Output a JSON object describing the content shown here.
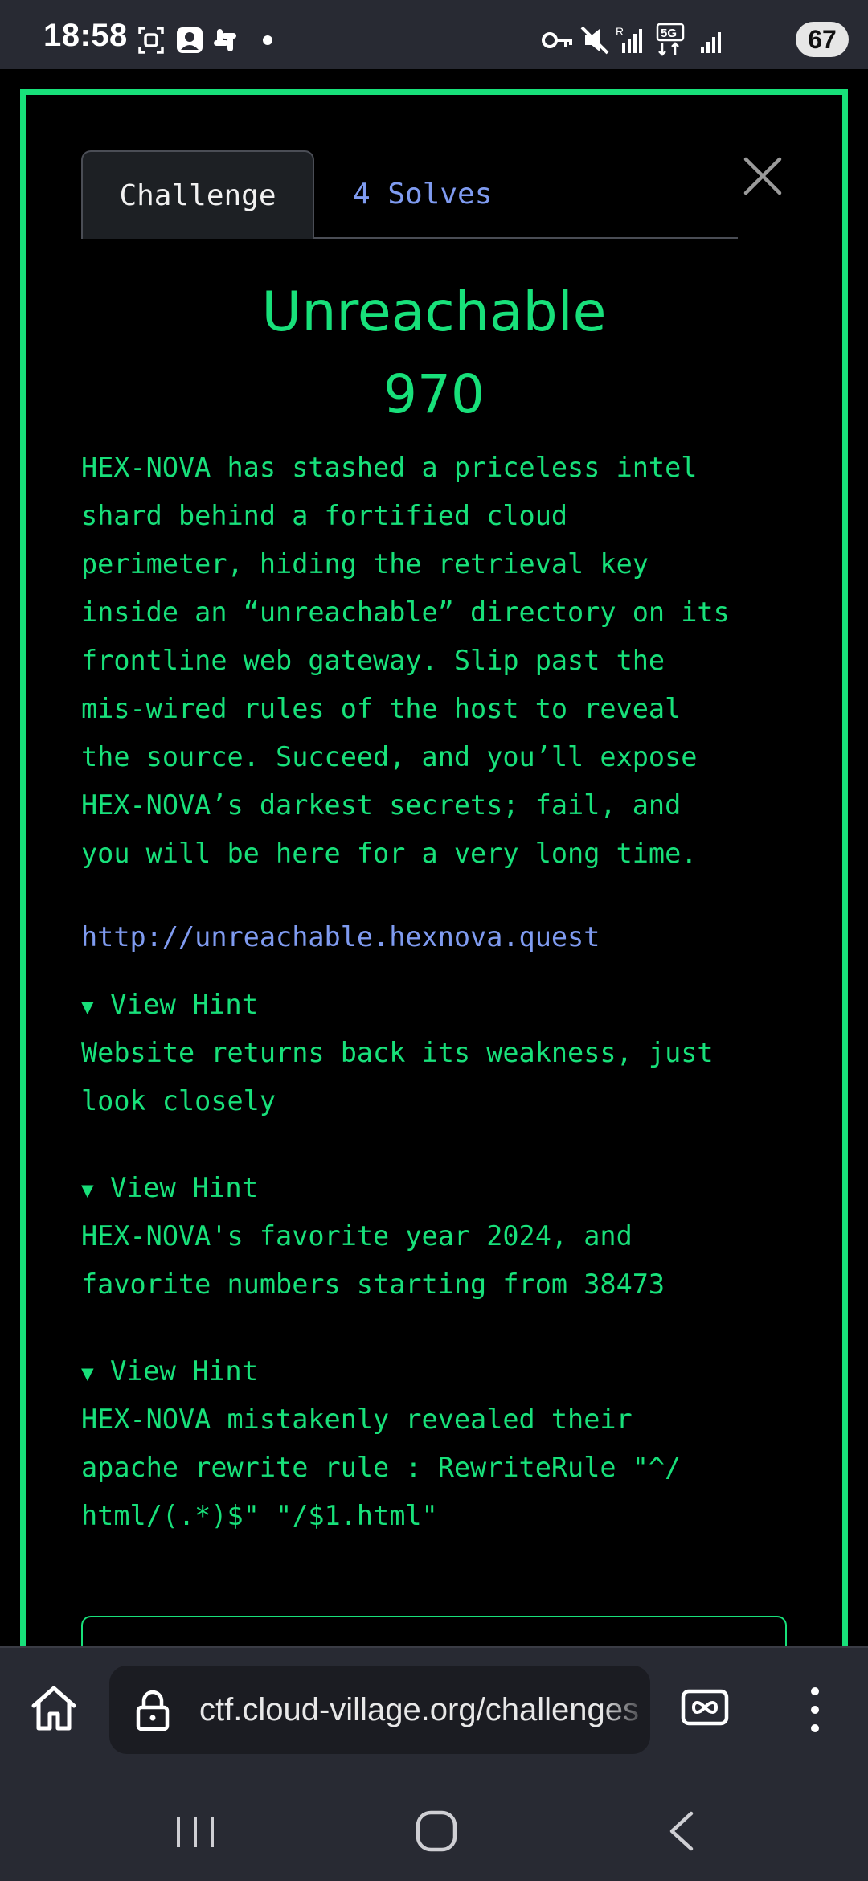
{
  "status_bar": {
    "time": "18:58",
    "battery": "67"
  },
  "tabs": {
    "challenge_label": "Challenge",
    "solves_label": "4 Solves"
  },
  "challenge": {
    "name": "Unreachable",
    "points": "970",
    "description": "HEX-NOVA has stashed a priceless intel\nshard behind a fortified cloud\nperimeter, hiding the retrieval key\ninside an “unreachable” directory on its\nfrontline web gateway. Slip past the\nmis-wired rules of the host to reveal\nthe source. Succeed, and you’ll expose\nHEX-NOVA’s darkest secrets; fail, and\nyou will be here for a very long time.",
    "url": "http://unreachable.hexnova.quest"
  },
  "hints": [
    {
      "toggle_label": "View Hint",
      "arrow": "▼",
      "text": "Website returns back its weakness, just\nlook closely"
    },
    {
      "toggle_label": "View Hint",
      "arrow": "▼",
      "text": "HEX-NOVA's favorite year 2024, and\nfavorite numbers starting from 38473"
    },
    {
      "toggle_label": "View Hint",
      "arrow": "▼",
      "text": "HEX-NOVA mistakenly revealed their\napache rewrite rule : RewriteRule \"^/\nhtml/(.*)$\" \"/$1.html\""
    }
  ],
  "browser": {
    "url_text": "ctf.cloud-village.org/challenges"
  },
  "colors": {
    "accent_green": "#18e07a",
    "link_blue": "#7f9bf0",
    "chrome_bg": "#282a33"
  },
  "icons": {
    "status_left": [
      "screenshot-icon",
      "app-icon",
      "slack-icon",
      "dot-icon"
    ],
    "status_right": [
      "vpn-key-icon",
      "mute-icon",
      "signal-r-icon",
      "5g-icon",
      "signal-icon"
    ],
    "browser": [
      "home-icon",
      "lock-icon",
      "tab-switcher-icon",
      "more-vert-icon"
    ],
    "nav": [
      "recents-icon",
      "home-circle-icon",
      "back-icon"
    ]
  }
}
